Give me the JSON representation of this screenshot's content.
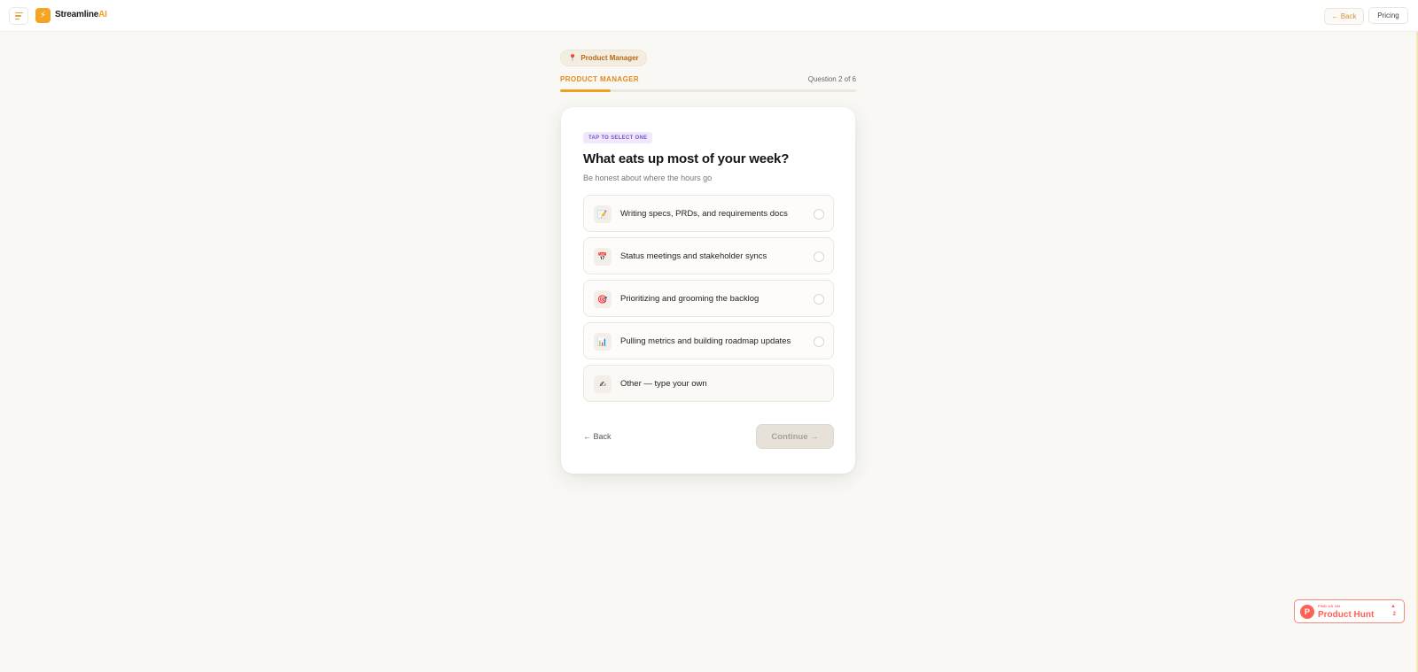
{
  "header": {
    "brand_main": "Streamline",
    "brand_accent": "AI",
    "back_label": "← Back",
    "pricing_label": "Pricing"
  },
  "progress": {
    "role_pill": "Product Manager",
    "role_label": "PRODUCT MANAGER",
    "count_label": "Question 2 of 6",
    "fraction": 0.17
  },
  "question": {
    "chip": "TAP TO SELECT ONE",
    "title": "What eats up most of your week?",
    "subtitle": "Be honest about where the hours go",
    "options": [
      {
        "icon": "📝",
        "icon_name": "memo-icon",
        "label": "Writing specs, PRDs, and requirements docs"
      },
      {
        "icon": "📅",
        "icon_name": "calendar-icon",
        "label": "Status meetings and stakeholder syncs"
      },
      {
        "icon": "🎯",
        "icon_name": "target-icon",
        "label": "Prioritizing and grooming the backlog"
      },
      {
        "icon": "📊",
        "icon_name": "bar-chart-icon",
        "label": "Pulling metrics and building roadmap updates"
      },
      {
        "icon": "✍",
        "icon_name": "writing-hand-icon",
        "label": "Other — type your own"
      }
    ],
    "back_label": "← Back",
    "continue_label": "Continue →"
  },
  "product_hunt": {
    "small_text": "FIND US ON",
    "name": "Product Hunt",
    "count": "2"
  },
  "colors": {
    "accent": "#f0a020",
    "chip_purple": "#7a4fd2",
    "product_hunt": "#ff6154"
  }
}
